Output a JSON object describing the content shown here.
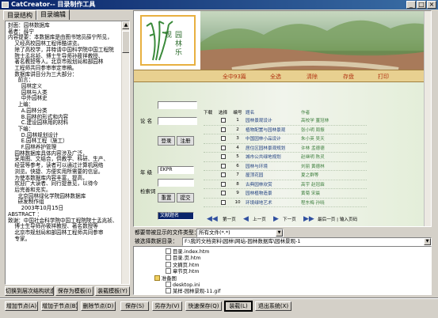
{
  "window": {
    "title": "CatCreator-- 目录制作工具",
    "buttons": [
      "_",
      "□",
      "×"
    ]
  },
  "tabs": [
    "目录结构",
    "目录编辑"
  ],
  "left_panel": {
    "lines": [
      "封面：园林数据库",
      "著者：薛宁",
      "内容提要：本数据库是由图书馆员薛宁所见，",
      "    又经高校园林工程师酷讲览。",
      "    除了高校学，并特请中国科学院中国工程院",
      "    院士孟兆祯、博士生导师孙筱祥教授、",
      "    著名教授等人。北京市规划局和部园林",
      "    工程师共同参审审定审稿。",
      "    数据库讲目分为三大部分：",
      "      前言：",
      "        园林定义",
      "        园林与人类",
      "        中外园林史",
      "      上编：",
      "        A.园林分类",
      "        B.园林的形式和内容",
      "        C.建设园林用的材料",
      "      下编：",
      "        D.园林规划设计",
      "        E.园林工程（施工）",
      "        F.园林养护管理",
      "    园林数据库具体内容涉及广泛，",
      "    采用图、文结合，供教学、科研、生产、",
      "    经营等参考，读者可以通过计算机网络",
      "    浏览。快捷、方便实用所需要的信息。",
      "    为使本数据库内容丰富，提高，",
      "    欢迎广大读者、同行提意见，以待今",
      "    后完善和充实。",
      "      北京园林绿化学院园林数据库",
      "      研发制作组",
      "        2003年10月15日",
      "ABSTRACT ：",
      "致谢：中国社会科学院中国工程院院士孟兆祯、",
      "    博士生导师孙筱祥教授、著名数授等",
      "    北京市规划局和部园林工程师共同参审",
      "    专家。"
    ]
  },
  "left_buttons": [
    "切换到层次结构状态(Q)",
    "保存为模板(I)",
    "装载模板(Y)"
  ],
  "preview": {
    "logo_text": "园林乐观",
    "nav": [
      "全中93篇",
      "全选",
      "清除",
      "存盘",
      "打印"
    ],
    "labels": {
      "keyword": "论 名",
      "year": "年 级",
      "search": "检索词"
    },
    "year_value": "EKPR",
    "search_value": "文献题名",
    "buttons": {
      "login": "登录",
      "register": "注册",
      "reset": "重置",
      "submit": "提交"
    },
    "table_headers": [
      "下载",
      "选择",
      "编号",
      "题名",
      "作者"
    ],
    "rows": [
      {
        "num": "1",
        "title": "园林景观设计",
        "author": "高校学  董冠林"
      },
      {
        "num": "2",
        "title": "植物配置与园林景观",
        "author": "张小明  周振"
      },
      {
        "num": "3",
        "title": "中国园林小品设计",
        "author": "朱小英  吴天"
      },
      {
        "num": "4",
        "title": "居住区园林景观规划",
        "author": "许林  孟德德"
      },
      {
        "num": "5",
        "title": "城市公共绿地规划",
        "author": "赵继明  陈灵"
      },
      {
        "num": "6",
        "title": "园林与环境",
        "author": "刘丽  黄德林"
      },
      {
        "num": "7",
        "title": "屋顶花园",
        "author": "夏之群等"
      },
      {
        "num": "8",
        "title": "古典园林欣赏",
        "author": "高宇  赵冠霖"
      },
      {
        "num": "9",
        "title": "园林植物造景",
        "author": "黄菊  宋晨"
      },
      {
        "num": "10",
        "title": "环境绿地艺术",
        "author": "程东梅  孙晓"
      }
    ],
    "pager": {
      "first": "第一页",
      "prev": "上一页",
      "next": "下一页",
      "last": "最后一页 | 输入页码"
    }
  },
  "file_type": {
    "label": "都要带被显示的文件类型：",
    "value": "所有文件(*.*)"
  },
  "root_dir": {
    "label": "被选择数据目录：",
    "value": "F:\\我的文档资料\\园林\\网站-园林数据库\\园林景观-1"
  },
  "tree": [
    {
      "name": "目录.index.htm",
      "type": "file"
    },
    {
      "name": "目录.页.htm",
      "type": "file"
    },
    {
      "name": "文摘页.htm",
      "type": "file"
    },
    {
      "name": "章节页.htm",
      "type": "file"
    },
    {
      "name": "准备图",
      "type": "folder"
    },
    {
      "name": "desktop.ini",
      "type": "file"
    },
    {
      "name": "某样-园林景观-11.gif",
      "type": "file"
    }
  ],
  "bottom_buttons": [
    "增加节点(A)",
    "增加子节点(B)",
    "删除节点(D)",
    "保存(S)",
    "另存为(V)",
    "快速保存(Q)",
    "装载(L)",
    "退出系统(X)"
  ]
}
